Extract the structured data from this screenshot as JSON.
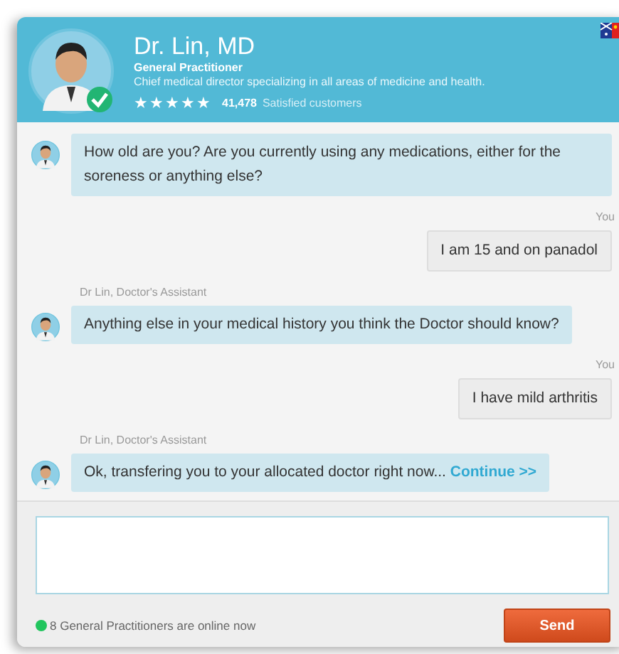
{
  "doctor": {
    "name": "Dr. Lin, MD",
    "verified": true,
    "role": "General Practitioner",
    "description": "Chief medical director specializing in all areas of medicine and health.",
    "stars": 5,
    "customers_count": "41,478",
    "customers_label": "Satisfied customers"
  },
  "messages": [
    {
      "kind": "doctor",
      "text": "How old are you? Are you currently using any medications, either for the soreness or anything else?"
    },
    {
      "kind": "user",
      "sender": "You",
      "text": "I am 15 and on panadol"
    },
    {
      "kind": "doctor",
      "sender": "Dr Lin, Doctor's Assistant",
      "text": "Anything else in your medical history you think the Doctor should know?"
    },
    {
      "kind": "user",
      "sender": "You",
      "text": "I have mild arthritis"
    },
    {
      "kind": "doctor",
      "sender": "Dr Lin, Doctor's Assistant",
      "text": "Ok, transfering you to your allocated doctor right now...",
      "link": "Continue >>"
    }
  ],
  "composer": {
    "color": "#22c55e",
    "status": "8 General Practitioners are online now",
    "send_button": "Send"
  }
}
